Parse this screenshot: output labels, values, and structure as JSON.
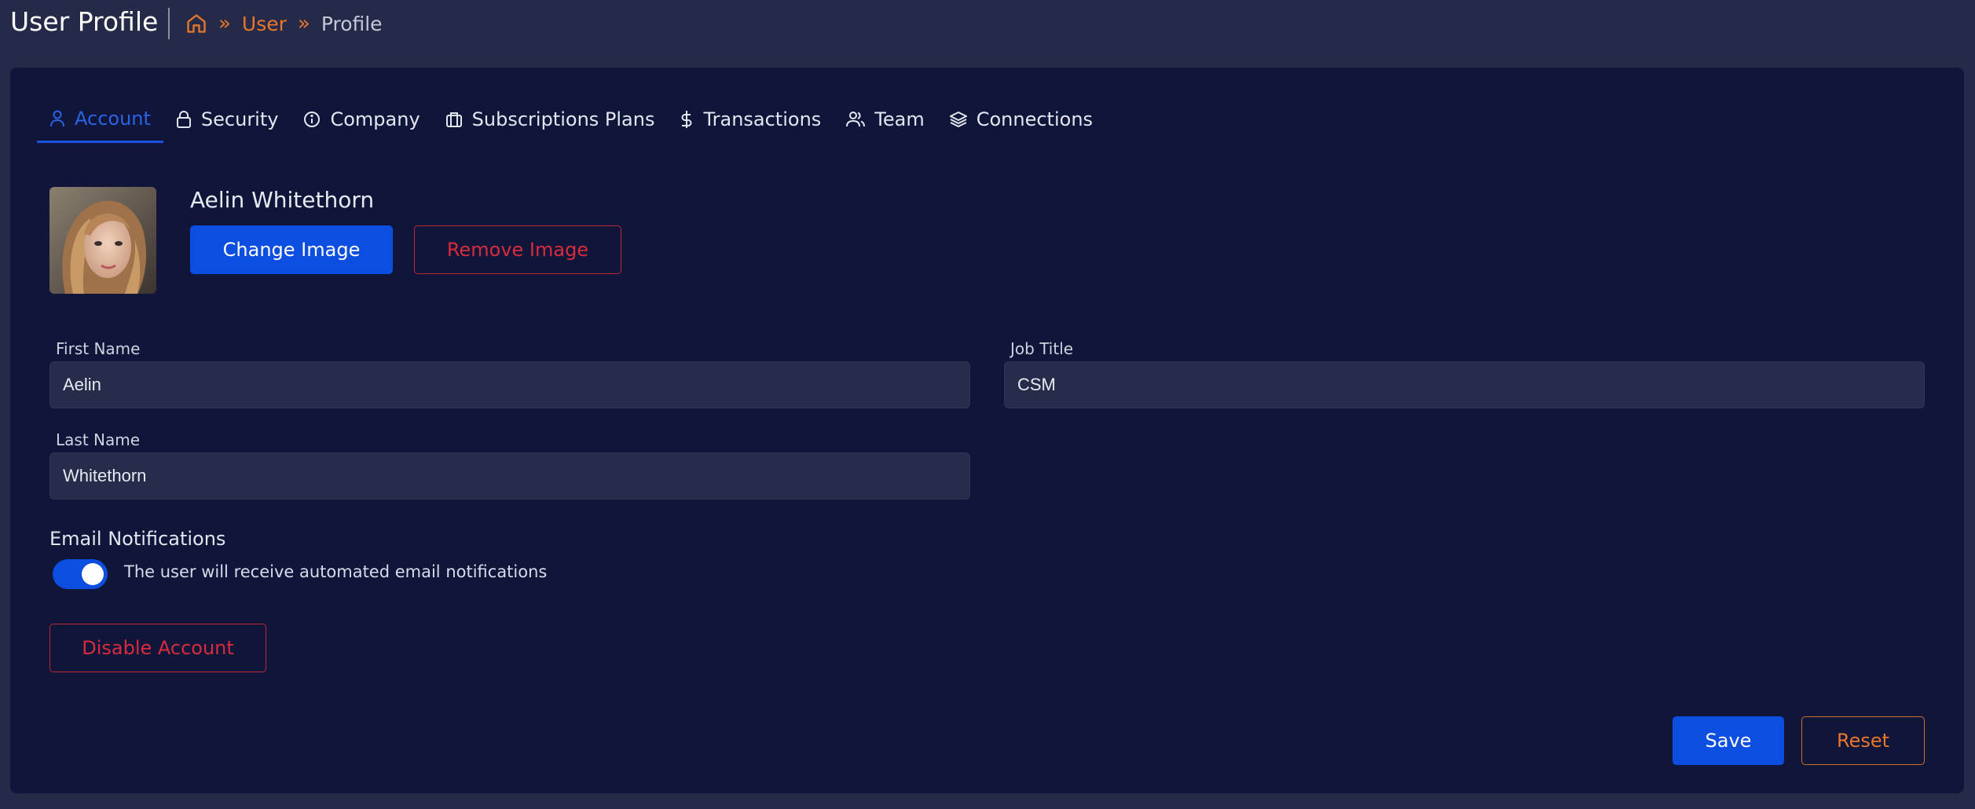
{
  "header": {
    "title": "User Profile",
    "breadcrumb": {
      "home_icon": "home-icon",
      "separator": "»",
      "user": "User",
      "current": "Profile"
    }
  },
  "tabs": [
    {
      "label": "Account",
      "icon": "user-icon",
      "active": true
    },
    {
      "label": "Security",
      "icon": "lock-icon",
      "active": false
    },
    {
      "label": "Company",
      "icon": "info-icon",
      "active": false
    },
    {
      "label": "Subscriptions Plans",
      "icon": "briefcase-icon",
      "active": false
    },
    {
      "label": "Transactions",
      "icon": "dollar-icon",
      "active": false
    },
    {
      "label": "Team",
      "icon": "users-icon",
      "active": false
    },
    {
      "label": "Connections",
      "icon": "layers-icon",
      "active": false
    }
  ],
  "profile": {
    "name": "Aelin Whitethorn",
    "change_image_label": "Change Image",
    "remove_image_label": "Remove Image"
  },
  "form": {
    "first_name": {
      "label": "First Name",
      "value": "Aelin"
    },
    "last_name": {
      "label": "Last Name",
      "value": "Whitethorn"
    },
    "job_title": {
      "label": "Job Title",
      "value": "CSM"
    }
  },
  "notifications": {
    "title": "Email Notifications",
    "toggle_on": true,
    "description": "The user will receive automated email notifications"
  },
  "actions": {
    "disable_label": "Disable Account",
    "save_label": "Save",
    "reset_label": "Reset"
  },
  "colors": {
    "background": "#252a48",
    "card": "#0f1639",
    "primary": "#0b4ee0",
    "danger": "#d92b3d",
    "accent_orange": "#e8762c"
  }
}
